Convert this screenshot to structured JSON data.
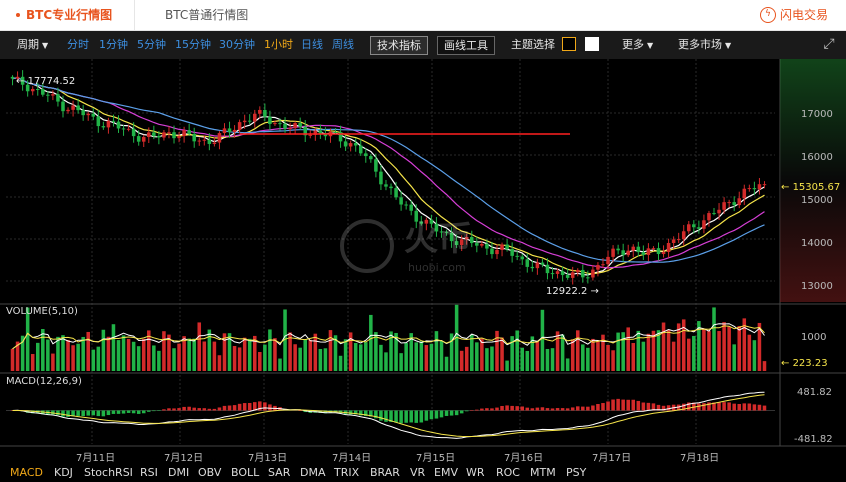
{
  "tabs": {
    "pro_label": "BTC专业行情图",
    "basic_label": "BTC普通行情图",
    "brand": "闪电交易"
  },
  "toolbar": {
    "period_label": "周期",
    "timeframes": [
      "分时",
      "1分钟",
      "5分钟",
      "15分钟",
      "30分钟",
      "1小时",
      "日线",
      "周线"
    ],
    "active_timeframe": "1小时",
    "tech_button": "技术指标",
    "draw_button": "画线工具",
    "theme_label": "主题选择",
    "more_label": "更多",
    "more_market_label": "更多市场"
  },
  "chart_data": [
    {
      "type": "candlestick",
      "title": "",
      "price_ticks": [
        17000,
        16000,
        15000,
        14000,
        13000
      ],
      "ylim": [
        12500,
        18000
      ],
      "max_label": "17774.52",
      "min_label": "12922.2",
      "last_price": "15305.67",
      "date_labels": [
        "7月11日",
        "7月12日",
        "7月13日",
        "7月14日",
        "7月15日",
        "7月16日",
        "7月17日",
        "7月18日"
      ],
      "resistance_line": 16500,
      "series": [
        {
          "name": "close",
          "values": [
            17760,
            17700,
            17520,
            17400,
            17200,
            17100,
            16950,
            16800,
            16750,
            16620,
            16500,
            16400,
            16450,
            16550,
            16480,
            16380,
            16320,
            16420,
            16600,
            16820,
            16950,
            16880,
            16720,
            16650,
            16580,
            16540,
            16480,
            16400,
            16250,
            16000,
            15600,
            15200,
            14850,
            14600,
            14400,
            14200,
            14050,
            13950,
            13900,
            13800,
            13750,
            13700,
            13500,
            13350,
            13250,
            13200,
            13150,
            13100,
            13300,
            13550,
            13700,
            13800,
            13650,
            13700,
            13850,
            14050,
            14300,
            14450,
            14650,
            14850,
            15050,
            15200,
            15305.67
          ]
        }
      ]
    },
    {
      "type": "bar",
      "title": "VOLUME(5,10)",
      "yticks": [
        1000
      ],
      "last_value": "223.23"
    },
    {
      "type": "bar",
      "title": "MACD(12,26,9)",
      "yticks": [
        481.82,
        -481.82
      ]
    }
  ],
  "indicators": [
    "MACD",
    "KDJ",
    "StochRSI",
    "RSI",
    "DMI",
    "OBV",
    "BOLL",
    "SAR",
    "DMA",
    "TRIX",
    "BRAR",
    "VR",
    "EMV",
    "WR",
    "ROC",
    "MTM",
    "PSY"
  ],
  "active_indicator": "MACD",
  "watermark": {
    "cn": "火币",
    "en": "huobi.com"
  },
  "colors": {
    "up": "#d32a2a",
    "down": "#21b348",
    "ma5": "#ffffff",
    "ma10": "#f5e44a",
    "ma20": "#d63fd6",
    "ma30": "#5b9fe8",
    "accent": "#e8541e"
  }
}
